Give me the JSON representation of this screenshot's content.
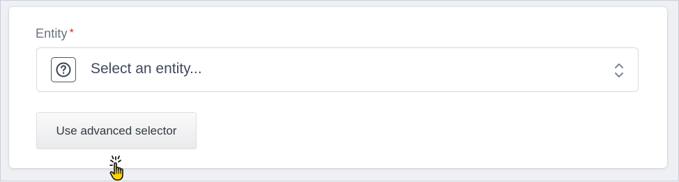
{
  "field": {
    "label": "Entity",
    "required_marker": "*",
    "placeholder": "Select an entity...",
    "leading_icon": "question-circle-icon",
    "trailing_icon": "chevron-up-down-icon"
  },
  "actions": {
    "advanced_selector_label": "Use advanced selector"
  },
  "cursor": {
    "icon": "pointer-hand-click-icon"
  },
  "colors": {
    "required": "#d12b2b",
    "cursor_fill": "#ffd400"
  }
}
